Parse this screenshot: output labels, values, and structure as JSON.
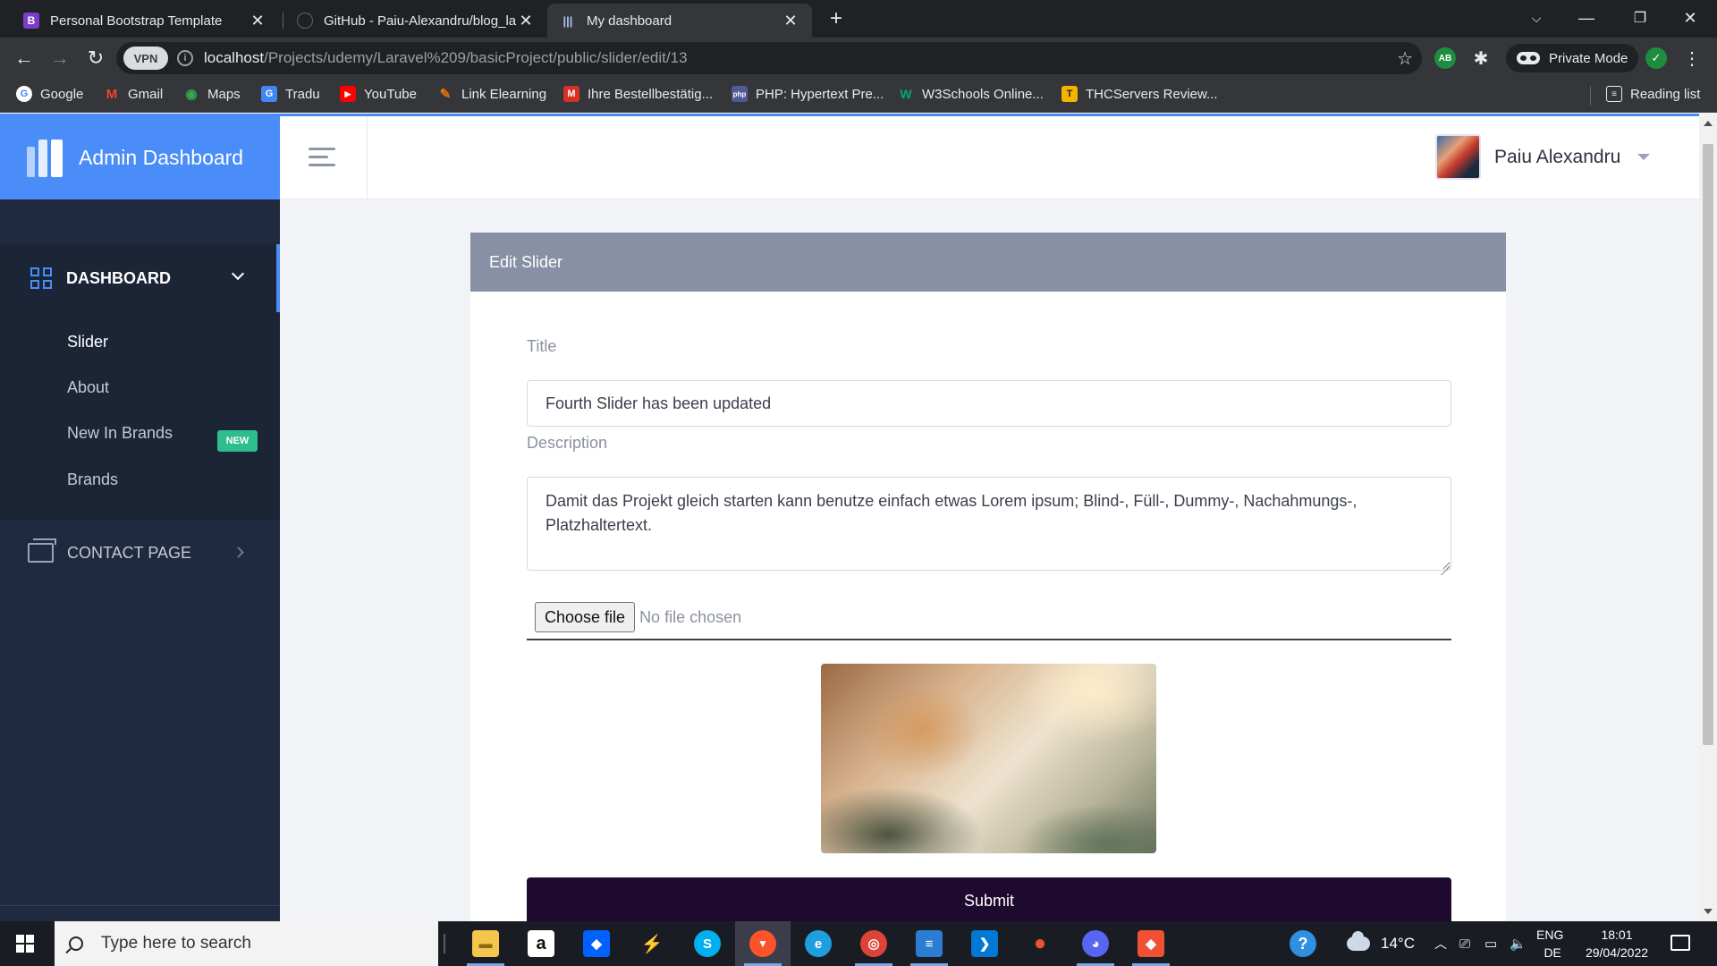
{
  "browser": {
    "tabs": [
      {
        "label": "Personal Bootstrap Template",
        "favicon": "B",
        "favicon_color": "#7a3ec8",
        "active": false
      },
      {
        "label": "GitHub - Paiu-Alexandru/blog_la",
        "favicon": "",
        "favicon_color": "#202124",
        "active": false
      },
      {
        "label": "My dashboard",
        "favicon": "|||",
        "favicon_color": "#35363a",
        "active": true
      }
    ],
    "vpn_label": "VPN",
    "url_host": "localhost",
    "url_path": "/Projects/udemy/Laravel%209/basicProject/public/slider/edit/13",
    "private_mode_label": "Private Mode",
    "bookmarks": [
      {
        "label": "Google",
        "icon": "G",
        "color": "#ffffff"
      },
      {
        "label": "Gmail",
        "icon": "M",
        "color": "#ea4335"
      },
      {
        "label": "Maps",
        "icon": "◉",
        "color": "#34a853"
      },
      {
        "label": "Tradu",
        "icon": "G",
        "color": "#4285f4"
      },
      {
        "label": "YouTube",
        "icon": "▶",
        "color": "#ff0000"
      },
      {
        "label": "Link Elearning",
        "icon": "✎",
        "color": "#e8710a"
      },
      {
        "label": "Ihre Bestellbestätig...",
        "icon": "M",
        "color": "#d93025"
      },
      {
        "label": "PHP: Hypertext Pre...",
        "icon": "php",
        "color": "#4f5b93"
      },
      {
        "label": "W3Schools Online...",
        "icon": "W",
        "color": "#04aa6d"
      },
      {
        "label": "THCServers Review...",
        "icon": "T",
        "color": "#f4b400"
      }
    ],
    "reading_list_label": "Reading list"
  },
  "sidebar": {
    "brand_title": "Admin Dashboard",
    "dashboard_label": "DASHBOARD",
    "submenu": [
      {
        "label": "Slider",
        "active": true
      },
      {
        "label": "About",
        "active": false
      },
      {
        "label": "New In Brands",
        "active": false,
        "badge": "NEW"
      },
      {
        "label": "Brands",
        "active": false
      }
    ],
    "contact_label": "CONTACT PAGE"
  },
  "topbar": {
    "user_name": "Paiu Alexandru"
  },
  "form": {
    "card_title": "Edit Slider",
    "title_label": "Title",
    "title_value": "Fourth Slider has been updated",
    "description_label": "Description",
    "description_value": "Damit das Projekt gleich starten kann benutze einfach etwas Lorem ipsum; Blind-, Füll-, Dummy-, Nachahmungs-, Platzhaltertext.",
    "choose_file_label": "Choose file",
    "no_file_label": "No file chosen",
    "submit_label": "Submit"
  },
  "taskbar": {
    "search_placeholder": "Type here to search",
    "apps": [
      {
        "name": "file-explorer",
        "glyph": "▬",
        "color": "#f4c64e",
        "running": true
      },
      {
        "name": "amazon",
        "glyph": "a",
        "color": "#ffffff",
        "running": false
      },
      {
        "name": "dropbox",
        "glyph": "◆",
        "color": "#0061fe",
        "running": false
      },
      {
        "name": "cursor-app",
        "glyph": "⚡",
        "color": "#1a1c24",
        "running": false
      },
      {
        "name": "skype",
        "glyph": "S",
        "color": "#00aff0",
        "running": false
      },
      {
        "name": "brave",
        "glyph": "▼",
        "color": "#fb542b",
        "running": true
      },
      {
        "name": "edge",
        "glyph": "e",
        "color": "#1f9ede",
        "running": false
      },
      {
        "name": "chrome",
        "glyph": "◎",
        "color": "#db4437",
        "running": true
      },
      {
        "name": "notepad",
        "glyph": "≡",
        "color": "#2b7cd3",
        "running": true
      },
      {
        "name": "vscode",
        "glyph": "❯",
        "color": "#0078d4",
        "running": false
      },
      {
        "name": "drop-app",
        "glyph": "●",
        "color": "#e8542e",
        "running": false
      },
      {
        "name": "discord",
        "glyph": "◕",
        "color": "#5865f2",
        "running": true
      },
      {
        "name": "git-app",
        "glyph": "◆",
        "color": "#f05033",
        "running": true
      }
    ],
    "temperature": "14°C",
    "language_top": "ENG",
    "language_bottom": "DE",
    "time": "18:01",
    "date": "29/04/2022"
  }
}
